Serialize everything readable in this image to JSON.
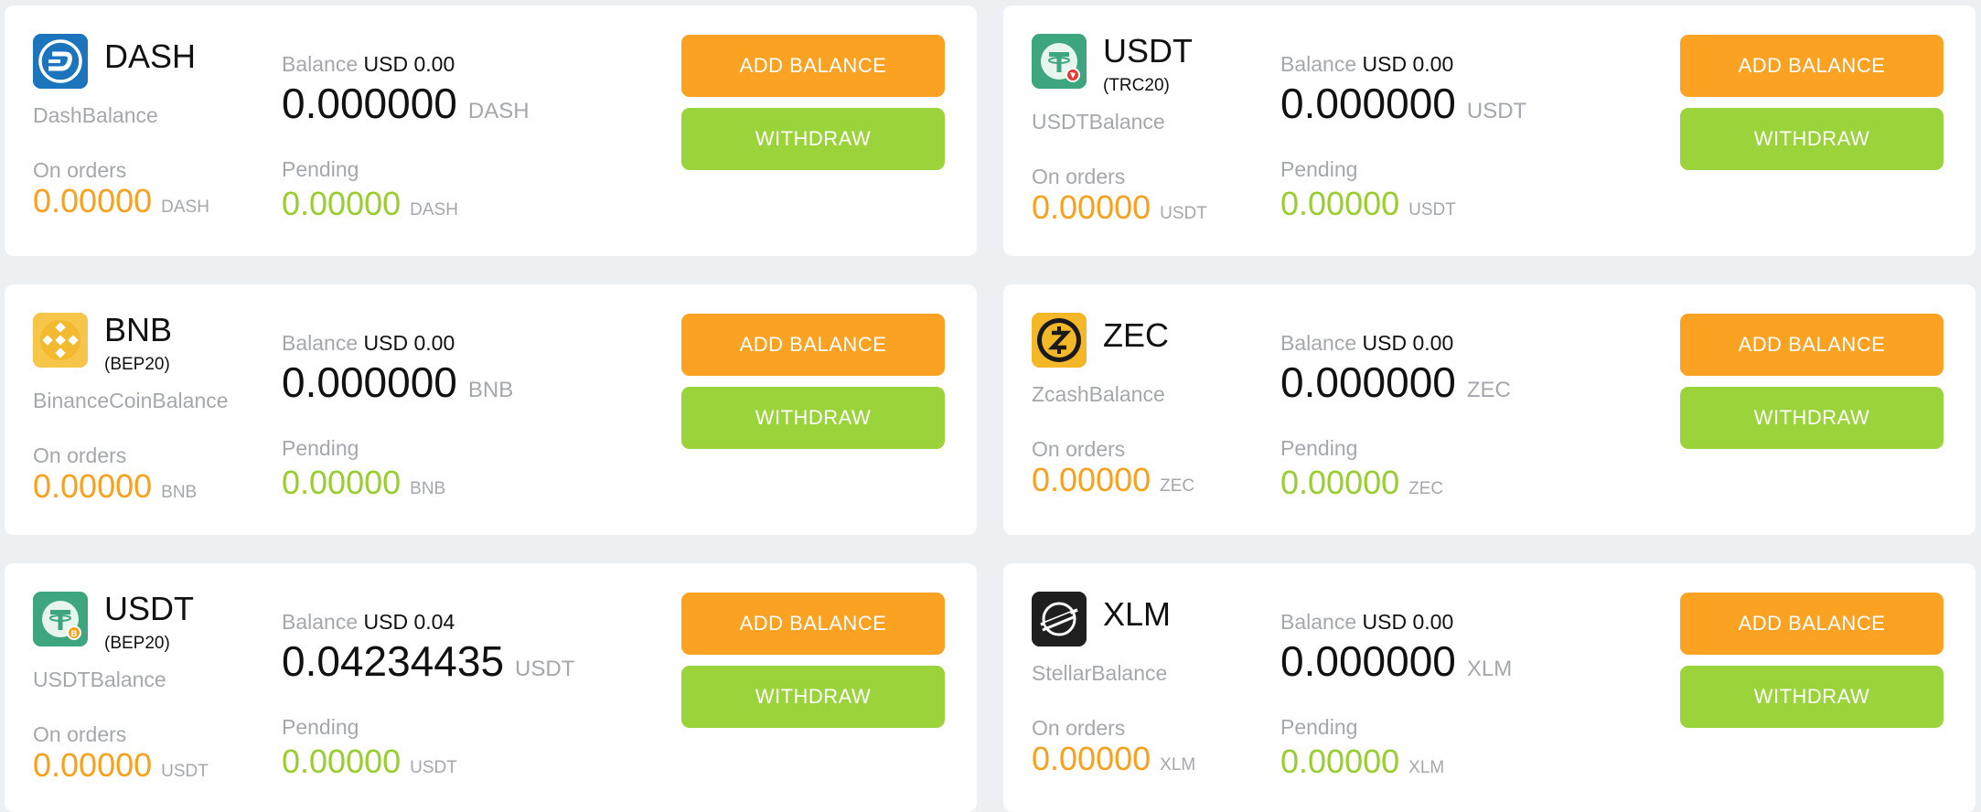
{
  "colors": {
    "add_button": "#fba222",
    "withdraw_button": "#9bd33b",
    "on_orders_value": "#f7a11e",
    "pending_value": "#9acd32",
    "muted_text": "#a4a8ad"
  },
  "labels": {
    "balance": "Balance",
    "on_orders": "On orders",
    "pending": "Pending",
    "add_balance": "ADD BALANCE",
    "withdraw": "WITHDRAW"
  },
  "wallets": [
    {
      "icon": "dash-icon",
      "name": "DASH",
      "network": "",
      "subtitle": "DashBalance",
      "usd": "USD 0.00",
      "amount": "0.000000",
      "unit": "DASH",
      "on_orders": "0.00000",
      "pending": "0.00000"
    },
    {
      "icon": "usdt-tron-icon",
      "name": "USDT",
      "network": "(TRC20)",
      "subtitle": "USDTBalance",
      "usd": "USD 0.00",
      "amount": "0.000000",
      "unit": "USDT",
      "on_orders": "0.00000",
      "pending": "0.00000"
    },
    {
      "icon": "bnb-icon",
      "name": "BNB",
      "network": "(BEP20)",
      "subtitle": "BinanceCoinBalance",
      "usd": "USD 0.00",
      "amount": "0.000000",
      "unit": "BNB",
      "on_orders": "0.00000",
      "pending": "0.00000"
    },
    {
      "icon": "zec-icon",
      "name": "ZEC",
      "network": "",
      "subtitle": "ZcashBalance",
      "usd": "USD 0.00",
      "amount": "0.000000",
      "unit": "ZEC",
      "on_orders": "0.00000",
      "pending": "0.00000"
    },
    {
      "icon": "usdt-bep20-icon",
      "name": "USDT",
      "network": "(BEP20)",
      "subtitle": "USDTBalance",
      "usd": "USD 0.04",
      "amount": "0.04234435",
      "unit": "USDT",
      "on_orders": "0.00000",
      "pending": "0.00000"
    },
    {
      "icon": "xlm-icon",
      "name": "XLM",
      "network": "",
      "subtitle": "StellarBalance",
      "usd": "USD 0.00",
      "amount": "0.000000",
      "unit": "XLM",
      "on_orders": "0.00000",
      "pending": "0.00000"
    }
  ]
}
